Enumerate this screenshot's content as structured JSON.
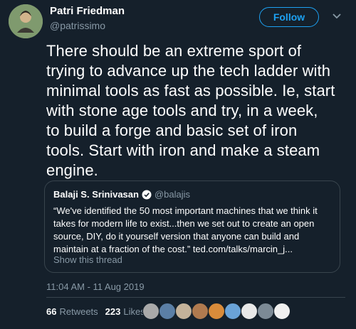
{
  "author": {
    "name": "Patri Friedman",
    "handle": "@patrissimo"
  },
  "follow_label": "Follow",
  "tweet_text": "There should be an extreme sport of\ntrying to advance up the tech ladder with\nminimal tools as fast as possible. Ie, start\nwith stone age tools and try, in a week,\nto build a forge and basic set of iron\ntools. Start with iron and make a steam\nengine.",
  "quote": {
    "name": "Balaji S. Srinivasan",
    "handle": "@balajis",
    "text": "“We've identified the 50 most important machines that we think it takes for modern life to exist...then we set out to create an open source, DIY, do it yourself version that anyone can build and maintain at a fraction of the cost.” ted.com/talks/marcin_j...",
    "thread_label": "Show this thread"
  },
  "timestamp": "11:04 AM - 11 Aug 2019",
  "stats": {
    "retweets": "66",
    "retweets_label": "Retweets",
    "likes": "223",
    "likes_label": "Likes"
  },
  "likers": [
    {
      "icon": "liker-avatar-1-icon",
      "color": "#a9a9a9"
    },
    {
      "icon": "liker-avatar-2-icon",
      "color": "#5b7fa6"
    },
    {
      "icon": "liker-avatar-3-icon",
      "color": "#c4b29a"
    },
    {
      "icon": "liker-avatar-4-icon",
      "color": "#b07a4f"
    },
    {
      "icon": "liker-avatar-5-icon",
      "color": "#d98b3a"
    },
    {
      "icon": "liker-avatar-6-icon",
      "color": "#6aa3d8"
    },
    {
      "icon": "liker-avatar-7-icon",
      "color": "#e8e8e8"
    },
    {
      "icon": "liker-avatar-8-icon",
      "color": "#7c8a96"
    },
    {
      "icon": "liker-avatar-9-icon",
      "color": "#f0f0f0"
    }
  ],
  "colors": {
    "background": "#15202b",
    "accent": "#1da1f2",
    "secondary_text": "#8899a6",
    "border": "#38444d"
  }
}
